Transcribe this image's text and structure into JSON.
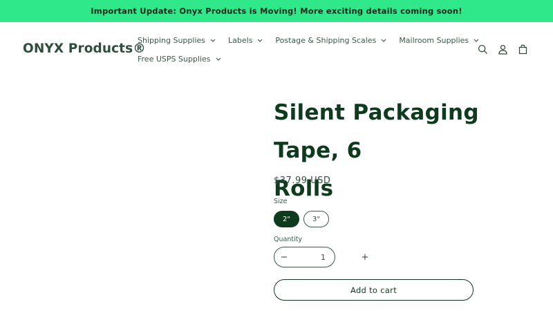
{
  "announcement": {
    "text": "Important Update: Onyx Products is Moving! More exciting details coming soon!",
    "background_color": "#2ee88a"
  },
  "header": {
    "logo": "ONYX Products®",
    "nav": {
      "row1": [
        {
          "label": "Shipping Supplies",
          "icon": "chevron-down-icon"
        },
        {
          "label": "Labels",
          "icon": "chevron-down-icon"
        },
        {
          "label": "Postage & Shipping Scales",
          "icon": "chevron-down-icon"
        },
        {
          "label": "Mailroom Supplies",
          "icon": "chevron-down-icon"
        }
      ],
      "row2": [
        {
          "label": "Free USPS Supplies",
          "icon": "chevron-down-icon"
        }
      ]
    },
    "icons": [
      "search-icon",
      "account-icon",
      "cart-icon"
    ]
  },
  "product": {
    "title_line1": "Silent Packaging Tape, 6",
    "title_line2": "Rolls",
    "price": "$37.99 USD",
    "size_label": "Size",
    "size_options": [
      {
        "label": "2\"",
        "selected": true
      },
      {
        "label": "3\"",
        "selected": false
      }
    ],
    "quantity_label": "Quantity",
    "quantity": "1",
    "decrease_label": "−",
    "increase_label": "+",
    "add_to_cart_label": "Add to cart",
    "accent_color": "#0e3a1e"
  }
}
